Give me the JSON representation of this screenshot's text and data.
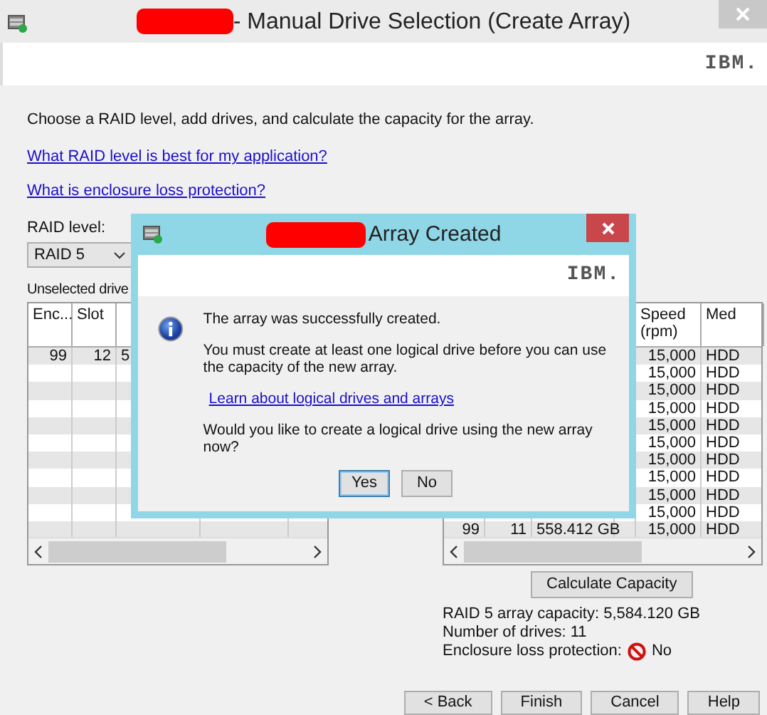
{
  "window": {
    "title": "- Manual Drive Selection (Create Array)",
    "logo": "IBM."
  },
  "intro": "Choose a RAID level, add drives, and calculate the capacity for the array.",
  "links": [
    "What RAID level is best for my application?",
    "What is enclosure loss protection?"
  ],
  "raid_level": {
    "label": "RAID level:",
    "value": "RAID 5"
  },
  "unselected": {
    "label": "Unselected drive",
    "columns": [
      "Enc...",
      "Slot"
    ],
    "rows": [
      {
        "cells": [
          "99",
          "12",
          "5"
        ]
      },
      {
        "cells": []
      },
      {
        "cells": []
      },
      {
        "cells": []
      },
      {
        "cells": []
      },
      {
        "cells": []
      },
      {
        "cells": []
      },
      {
        "cells": []
      },
      {
        "cells": []
      },
      {
        "cells": []
      },
      {
        "cells": []
      }
    ]
  },
  "selected": {
    "columns": [
      "",
      "",
      "",
      "",
      "Speed (rpm)",
      "Med"
    ],
    "rows": [
      {
        "cells": [
          "",
          "",
          "",
          "",
          "15,000",
          "HDD"
        ]
      },
      {
        "cells": [
          "",
          "",
          "",
          "",
          "15,000",
          "HDD"
        ]
      },
      {
        "cells": [
          "",
          "",
          "",
          "",
          "15,000",
          "HDD"
        ]
      },
      {
        "cells": [
          "",
          "",
          "",
          "",
          "15,000",
          "HDD"
        ]
      },
      {
        "cells": [
          "",
          "",
          "",
          "",
          "15,000",
          "HDD"
        ]
      },
      {
        "cells": [
          "",
          "",
          "",
          "",
          "15,000",
          "HDD"
        ]
      },
      {
        "cells": [
          "",
          "",
          "",
          "",
          "15,000",
          "HDD"
        ]
      },
      {
        "cells": [
          "",
          "",
          "",
          "",
          "15,000",
          "HDD"
        ]
      },
      {
        "cells": [
          "",
          "",
          "",
          "",
          "15,000",
          "HDD"
        ]
      },
      {
        "cells": [
          "",
          "",
          "",
          "",
          "15,000",
          "HDD"
        ]
      },
      {
        "cells": [
          "99",
          "11",
          "558.412 GB",
          "",
          "15,000",
          "HDD"
        ]
      }
    ]
  },
  "calculate_button": "Calculate Capacity",
  "summary": {
    "capacity": "RAID 5 array capacity: 5,584.120 GB",
    "drives": "Number of drives: 11",
    "protection_label": "Enclosure loss protection:",
    "protection_value": "No"
  },
  "buttons": [
    "< Back",
    "Finish",
    "Cancel",
    "Help"
  ],
  "dialog": {
    "title": "Array Created",
    "logo": "IBM.",
    "message": "The array was successfully created.",
    "detail": "You must create at least one logical drive before you can use the capacity of the new array.",
    "link": "Learn about logical drives and arrays",
    "question": "Would you like to create a logical drive using the new array now?",
    "buttons": [
      {
        "label": "Yes",
        "default": true
      },
      {
        "label": "No",
        "default": false
      }
    ]
  }
}
